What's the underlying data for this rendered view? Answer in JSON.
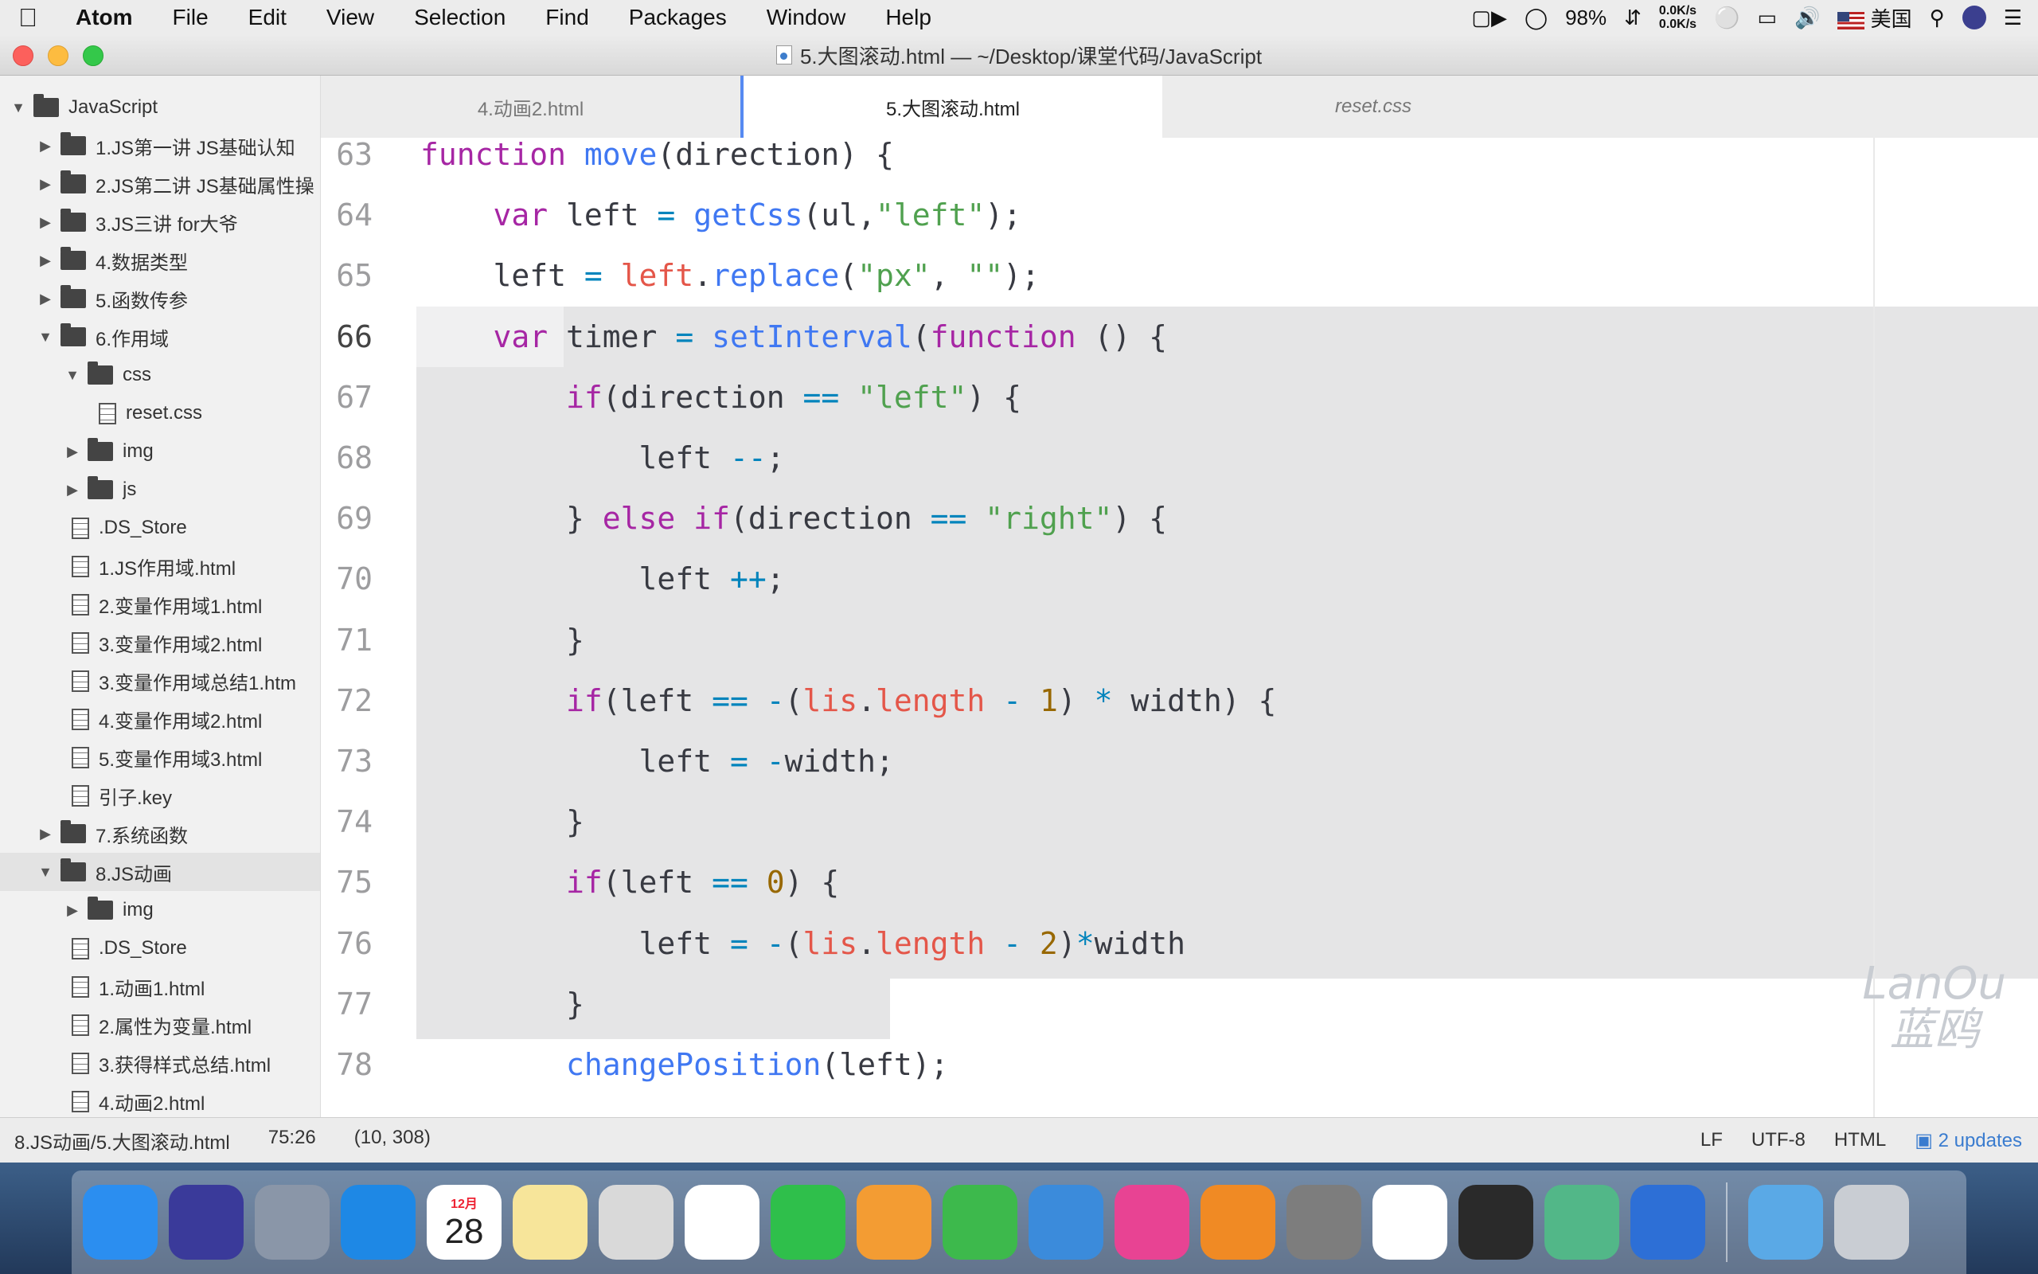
{
  "menubar": {
    "apple": "",
    "items": [
      "Atom",
      "File",
      "Edit",
      "View",
      "Selection",
      "Find",
      "Packages",
      "Window",
      "Help"
    ],
    "battery": "98%",
    "net_up": "0.0K/s",
    "net_down": "0.0K/s",
    "input_source": "美国"
  },
  "window": {
    "title": "5.大图滚动.html — ~/Desktop/课堂代码/JavaScript"
  },
  "tree": {
    "root": "JavaScript",
    "rows": [
      {
        "label": "1.JS第一讲 JS基础认知",
        "type": "folder",
        "depth": 1,
        "expanded": false
      },
      {
        "label": "2.JS第二讲 JS基础属性操",
        "type": "folder",
        "depth": 1,
        "expanded": false
      },
      {
        "label": "3.JS三讲 for大爷",
        "type": "folder",
        "depth": 1,
        "expanded": false
      },
      {
        "label": "4.数据类型",
        "type": "folder",
        "depth": 1,
        "expanded": false
      },
      {
        "label": "5.函数传参",
        "type": "folder",
        "depth": 1,
        "expanded": false
      },
      {
        "label": "6.作用域",
        "type": "folder",
        "depth": 1,
        "expanded": true
      },
      {
        "label": "css",
        "type": "folder",
        "depth": 2,
        "expanded": true
      },
      {
        "label": "reset.css",
        "type": "file",
        "depth": 3
      },
      {
        "label": "img",
        "type": "folder",
        "depth": 2,
        "expanded": false
      },
      {
        "label": "js",
        "type": "folder",
        "depth": 2,
        "expanded": false
      },
      {
        "label": ".DS_Store",
        "type": "file",
        "depth": 2
      },
      {
        "label": "1.JS作用域.html",
        "type": "file",
        "depth": 2
      },
      {
        "label": "2.变量作用域1.html",
        "type": "file",
        "depth": 2
      },
      {
        "label": "3.变量作用域2.html",
        "type": "file",
        "depth": 2
      },
      {
        "label": "3.变量作用域总结1.htm",
        "type": "file",
        "depth": 2
      },
      {
        "label": "4.变量作用域2.html",
        "type": "file",
        "depth": 2
      },
      {
        "label": "5.变量作用域3.html",
        "type": "file",
        "depth": 2
      },
      {
        "label": "引子.key",
        "type": "file",
        "depth": 2
      },
      {
        "label": "7.系统函数",
        "type": "folder",
        "depth": 1,
        "expanded": false
      },
      {
        "label": "8.JS动画",
        "type": "folder",
        "depth": 1,
        "expanded": true,
        "selected": true
      },
      {
        "label": "img",
        "type": "folder",
        "depth": 2,
        "expanded": false
      },
      {
        "label": ".DS_Store",
        "type": "file",
        "depth": 2
      },
      {
        "label": "1.动画1.html",
        "type": "file",
        "depth": 2
      },
      {
        "label": "2.属性为变量.html",
        "type": "file",
        "depth": 2
      },
      {
        "label": "3.获得样式总结.html",
        "type": "file",
        "depth": 2
      },
      {
        "label": "4.动画2.html",
        "type": "file",
        "depth": 2
      }
    ]
  },
  "tabs": [
    {
      "label": "4.动画2.html",
      "active": false
    },
    {
      "label": "5.大图滚动.html",
      "active": true
    },
    {
      "label": "reset.css",
      "active": false
    }
  ],
  "editor": {
    "lines": [
      {
        "n": "63",
        "indent": 1,
        "tokens": [
          [
            "kw",
            "function "
          ],
          [
            "fn",
            "move"
          ],
          [
            "p",
            "(direction) {"
          ]
        ]
      },
      {
        "n": "64",
        "indent": 2,
        "tokens": [
          [
            "kw",
            "var "
          ],
          [
            "p",
            "left "
          ],
          [
            "op",
            "= "
          ],
          [
            "fn",
            "getCss"
          ],
          [
            "p",
            "(ul,"
          ],
          [
            "str",
            "\"left\""
          ],
          [
            "p",
            ");"
          ]
        ]
      },
      {
        "n": "65",
        "indent": 2,
        "tokens": [
          [
            "p",
            "left "
          ],
          [
            "op",
            "= "
          ],
          [
            "prop",
            "left"
          ],
          [
            "p",
            "."
          ],
          [
            "fn",
            "replace"
          ],
          [
            "p",
            "("
          ],
          [
            "str",
            "\"px\""
          ],
          [
            "p",
            ", "
          ],
          [
            "str",
            "\"\""
          ],
          [
            "p",
            ");"
          ]
        ]
      },
      {
        "n": "66",
        "indent": 2,
        "cur": true,
        "tokens": [
          [
            "kw",
            "var "
          ],
          [
            "p",
            "timer "
          ],
          [
            "op",
            "= "
          ],
          [
            "fn",
            "setInterval"
          ],
          [
            "p",
            "("
          ],
          [
            "kw",
            "function "
          ],
          [
            "p",
            "() {"
          ]
        ]
      },
      {
        "n": "67",
        "indent": 3,
        "tokens": [
          [
            "kw",
            "if"
          ],
          [
            "p",
            "(direction "
          ],
          [
            "op",
            "== "
          ],
          [
            "str",
            "\"left\""
          ],
          [
            "p",
            ") {"
          ]
        ]
      },
      {
        "n": "68",
        "indent": 4,
        "tokens": [
          [
            "p",
            "left "
          ],
          [
            "op",
            "--"
          ],
          [
            "p",
            ";"
          ]
        ]
      },
      {
        "n": "69",
        "indent": 3,
        "tokens": [
          [
            "p",
            "} "
          ],
          [
            "kw",
            "else if"
          ],
          [
            "p",
            "(direction "
          ],
          [
            "op",
            "== "
          ],
          [
            "str",
            "\"right\""
          ],
          [
            "p",
            ") {"
          ]
        ]
      },
      {
        "n": "70",
        "indent": 4,
        "tokens": [
          [
            "p",
            "left "
          ],
          [
            "op",
            "++"
          ],
          [
            "p",
            ";"
          ]
        ]
      },
      {
        "n": "71",
        "indent": 3,
        "tokens": [
          [
            "p",
            "}"
          ]
        ]
      },
      {
        "n": "72",
        "indent": 3,
        "tokens": [
          [
            "kw",
            "if"
          ],
          [
            "p",
            "(left "
          ],
          [
            "op",
            "== -"
          ],
          [
            "p",
            "("
          ],
          [
            "prop",
            "lis"
          ],
          [
            "p",
            "."
          ],
          [
            "prop",
            "length "
          ],
          [
            "op",
            "- "
          ],
          [
            "numlit",
            "1"
          ],
          [
            "p",
            ") "
          ],
          [
            "op",
            "* "
          ],
          [
            "p",
            "width) {"
          ]
        ]
      },
      {
        "n": "73",
        "indent": 4,
        "tokens": [
          [
            "p",
            "left "
          ],
          [
            "op",
            "= -"
          ],
          [
            "p",
            "width;"
          ]
        ]
      },
      {
        "n": "74",
        "indent": 3,
        "tokens": [
          [
            "p",
            "}"
          ]
        ]
      },
      {
        "n": "75",
        "indent": 3,
        "tokens": [
          [
            "kw",
            "if"
          ],
          [
            "p",
            "(left "
          ],
          [
            "op",
            "== "
          ],
          [
            "numlit",
            "0"
          ],
          [
            "p",
            ") {"
          ]
        ]
      },
      {
        "n": "76",
        "indent": 4,
        "tokens": [
          [
            "p",
            "left "
          ],
          [
            "op",
            "= -"
          ],
          [
            "p",
            "("
          ],
          [
            "prop",
            "lis"
          ],
          [
            "p",
            "."
          ],
          [
            "prop",
            "length "
          ],
          [
            "op",
            "- "
          ],
          [
            "numlit",
            "2"
          ],
          [
            "p",
            ")"
          ],
          [
            "op",
            "*"
          ],
          [
            "p",
            "width"
          ]
        ]
      },
      {
        "n": "77",
        "indent": 3,
        "tokens": [
          [
            "p",
            "}"
          ]
        ]
      },
      {
        "n": "78",
        "indent": 3,
        "tokens": [
          [
            "fn",
            "changePosition"
          ],
          [
            "p",
            "(left);"
          ]
        ]
      }
    ],
    "watermark_top": "LanOu",
    "watermark_bottom": "蓝鸥"
  },
  "status": {
    "path": "8.JS动画/5.大图滚动.html",
    "cursor": "75:26",
    "selection": "(10, 308)",
    "line_ending": "LF",
    "encoding": "UTF-8",
    "grammar": "HTML",
    "updates": "2 updates"
  },
  "dock": {
    "calendar_month": "12月",
    "calendar_day": "28",
    "apps": [
      {
        "name": "finder",
        "color": "#2b8ef0"
      },
      {
        "name": "siri",
        "color": "#3a3a9a"
      },
      {
        "name": "launchpad",
        "color": "#8a96a8"
      },
      {
        "name": "safari",
        "color": "#1e88e5"
      },
      {
        "name": "calendar",
        "color": "#ffffff"
      },
      {
        "name": "notes",
        "color": "#f7e59a"
      },
      {
        "name": "preview",
        "color": "#d9d9d9"
      },
      {
        "name": "photos",
        "color": "#ffffff"
      },
      {
        "name": "facetime",
        "color": "#2fbf4b"
      },
      {
        "name": "pages",
        "color": "#f39c33"
      },
      {
        "name": "numbers",
        "color": "#3db94c"
      },
      {
        "name": "keynote",
        "color": "#3b8bdb"
      },
      {
        "name": "itunes",
        "color": "#e84393"
      },
      {
        "name": "ibooks",
        "color": "#f08a24"
      },
      {
        "name": "system-preferences",
        "color": "#7d7d7d"
      },
      {
        "name": "chrome",
        "color": "#ffffff"
      },
      {
        "name": "xmind",
        "color": "#2a2a2a"
      },
      {
        "name": "atom",
        "color": "#52b788"
      },
      {
        "name": "screen-recorder",
        "color": "#2d6fd6"
      },
      {
        "name": "downloads",
        "color": "#5aa9e6"
      },
      {
        "name": "trash",
        "color": "#c9cdd3"
      }
    ]
  }
}
